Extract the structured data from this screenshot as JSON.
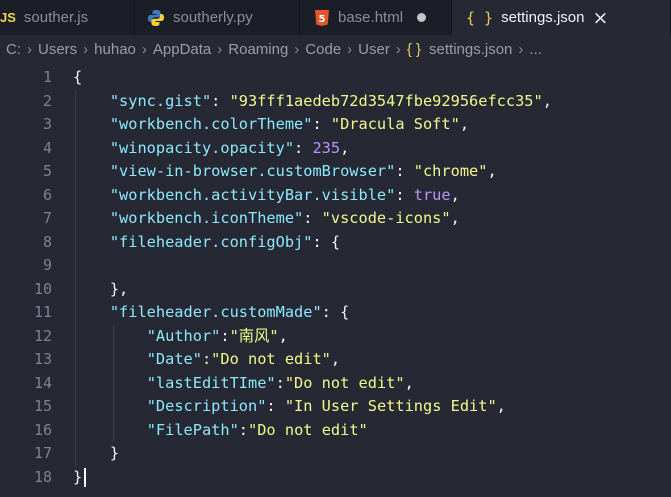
{
  "tabs": [
    {
      "label": "souther.js",
      "icon": "js-icon",
      "icon_text": "JS",
      "active": false
    },
    {
      "label": "southerly.py",
      "icon": "python-icon",
      "active": false
    },
    {
      "label": "base.html",
      "icon": "html5-icon",
      "icon_text": "5",
      "active": false,
      "modified": true
    },
    {
      "label": "settings.json",
      "icon": "json-braces-icon",
      "icon_text": "{ }",
      "active": true,
      "close": "×"
    }
  ],
  "breadcrumb": {
    "items": [
      "C:",
      "Users",
      "huhao",
      "AppData",
      "Roaming",
      "Code",
      "User"
    ],
    "file_icon": "{ }",
    "file": "settings.json",
    "trail": "..."
  },
  "editor": {
    "line_numbers": [
      "1",
      "2",
      "3",
      "4",
      "5",
      "6",
      "7",
      "8",
      "9",
      "10",
      "11",
      "12",
      "13",
      "14",
      "15",
      "16",
      "17",
      "18"
    ],
    "lines": [
      [
        [
          "p",
          "{"
        ]
      ],
      [
        [
          "p",
          "    "
        ],
        [
          "k",
          "\"sync.gist\""
        ],
        [
          "p",
          ": "
        ],
        [
          "s",
          "\"93fff1aedeb72d3547fbe92956efcc35\""
        ],
        [
          "p",
          ","
        ]
      ],
      [
        [
          "p",
          "    "
        ],
        [
          "k",
          "\"workbench.colorTheme\""
        ],
        [
          "p",
          ": "
        ],
        [
          "s",
          "\"Dracula Soft\""
        ],
        [
          "p",
          ","
        ]
      ],
      [
        [
          "p",
          "    "
        ],
        [
          "k",
          "\"winopacity.opacity\""
        ],
        [
          "p",
          ": "
        ],
        [
          "n",
          "235"
        ],
        [
          "p",
          ","
        ]
      ],
      [
        [
          "p",
          "    "
        ],
        [
          "k",
          "\"view-in-browser.customBrowser\""
        ],
        [
          "p",
          ": "
        ],
        [
          "s",
          "\"chrome\""
        ],
        [
          "p",
          ","
        ]
      ],
      [
        [
          "p",
          "    "
        ],
        [
          "k",
          "\"workbench.activityBar.visible\""
        ],
        [
          "p",
          ": "
        ],
        [
          "b",
          "true"
        ],
        [
          "p",
          ","
        ]
      ],
      [
        [
          "p",
          "    "
        ],
        [
          "k",
          "\"workbench.iconTheme\""
        ],
        [
          "p",
          ": "
        ],
        [
          "s",
          "\"vscode-icons\""
        ],
        [
          "p",
          ","
        ]
      ],
      [
        [
          "p",
          "    "
        ],
        [
          "k",
          "\"fileheader.configObj\""
        ],
        [
          "p",
          ": {"
        ]
      ],
      [
        [
          "p",
          ""
        ]
      ],
      [
        [
          "p",
          "    },"
        ]
      ],
      [
        [
          "p",
          "    "
        ],
        [
          "k",
          "\"fileheader.customMade\""
        ],
        [
          "p",
          ": {"
        ]
      ],
      [
        [
          "p",
          "        "
        ],
        [
          "k",
          "\"Author\""
        ],
        [
          "p",
          ":"
        ],
        [
          "s",
          "\"南风\""
        ],
        [
          "p",
          ","
        ]
      ],
      [
        [
          "p",
          "        "
        ],
        [
          "k",
          "\"Date\""
        ],
        [
          "p",
          ":"
        ],
        [
          "s",
          "\"Do not edit\""
        ],
        [
          "p",
          ","
        ]
      ],
      [
        [
          "p",
          "        "
        ],
        [
          "k",
          "\"lastEditTIme\""
        ],
        [
          "p",
          ":"
        ],
        [
          "s",
          "\"Do not edit\""
        ],
        [
          "p",
          ","
        ]
      ],
      [
        [
          "p",
          "        "
        ],
        [
          "k",
          "\"Description\""
        ],
        [
          "p",
          ": "
        ],
        [
          "s",
          "\"In User Settings Edit\""
        ],
        [
          "p",
          ","
        ]
      ],
      [
        [
          "p",
          "        "
        ],
        [
          "k",
          "\"FilePath\""
        ],
        [
          "p",
          ":"
        ],
        [
          "s",
          "\"Do not edit\""
        ]
      ],
      [
        [
          "p",
          "    }"
        ]
      ],
      [
        [
          "p",
          "}"
        ]
      ]
    ]
  },
  "colors": {
    "background": "#262833",
    "key": "#8be9fd",
    "string": "#f1fa8c",
    "number": "#bd93f9",
    "text": "#f8f8f2"
  }
}
